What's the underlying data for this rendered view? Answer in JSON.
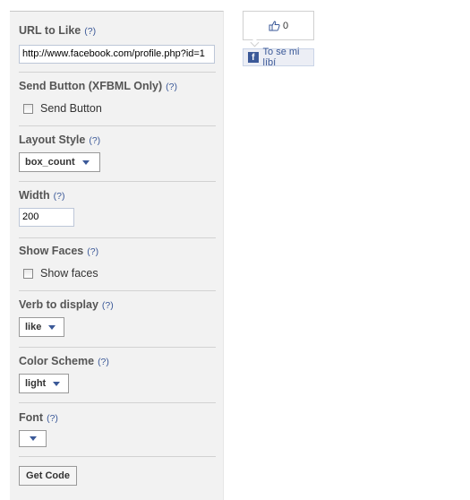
{
  "form": {
    "help_marker": "(?)",
    "url": {
      "label": "URL to Like",
      "value": "http://www.facebook.com/profile.php?id=1"
    },
    "send_button": {
      "label": "Send Button (XFBML Only)",
      "checkbox_label": "Send Button"
    },
    "layout_style": {
      "label": "Layout Style",
      "selected": "box_count"
    },
    "width": {
      "label": "Width",
      "value": "200"
    },
    "show_faces": {
      "label": "Show Faces",
      "checkbox_label": "Show faces"
    },
    "verb": {
      "label": "Verb to display",
      "selected": "like"
    },
    "color_scheme": {
      "label": "Color Scheme",
      "selected": "light"
    },
    "font": {
      "label": "Font",
      "selected": ""
    },
    "get_code_label": "Get Code"
  },
  "preview": {
    "count": "0",
    "like_label": "To se mi líbí",
    "logo_letter": "f"
  },
  "colors": {
    "accent": "#3b5998",
    "panel_bg": "#f2f2f2"
  },
  "icons": {
    "thumb": "thumbs-up-icon",
    "logo": "facebook-logo-icon",
    "caret": "chevron-down-icon"
  }
}
